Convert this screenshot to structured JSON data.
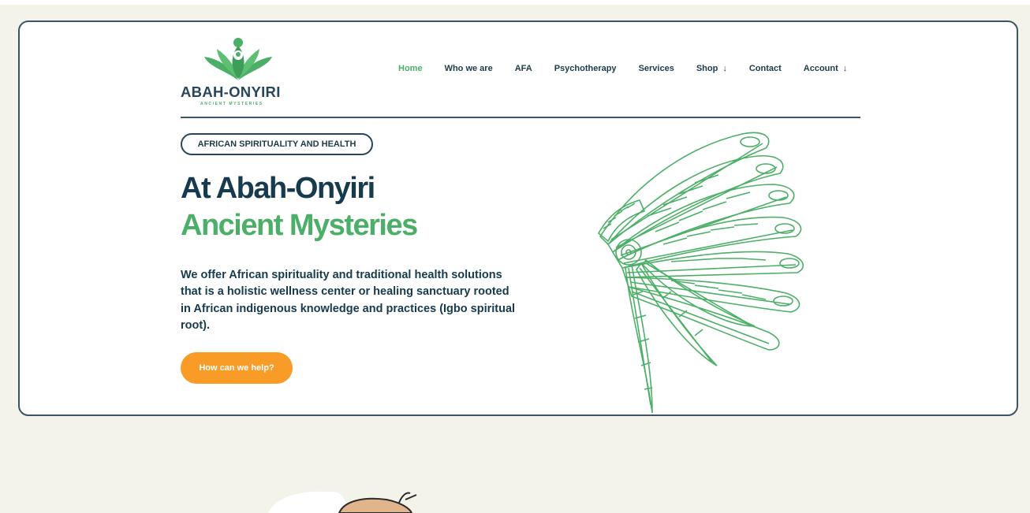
{
  "brand": {
    "name": "ABAH-ONYIRI",
    "tagline": "ANCIENT MYSTERIES"
  },
  "nav": {
    "items": [
      {
        "label": "Home",
        "active": true
      },
      {
        "label": "Who we are"
      },
      {
        "label": "AFA"
      },
      {
        "label": "Psychotherapy"
      },
      {
        "label": "Services"
      },
      {
        "label": "Shop",
        "dropdown": true
      },
      {
        "label": "Contact"
      },
      {
        "label": "Account",
        "dropdown": true
      }
    ]
  },
  "hero": {
    "badge": "AFRICAN SPIRITUALITY AND HEALTH",
    "title_line1": "At Abah-Onyiri",
    "title_line2": "Ancient Mysteries",
    "description": "We offer African spirituality and traditional health solutions that is a holistic wellness center or healing sanctuary rooted in African indigenous knowledge and practices (Igbo spiritual root).",
    "cta_label": "How can we help?",
    "illustration": "feather-headdress-illustration"
  },
  "colors": {
    "background": "#f3f3ea",
    "dark_text": "#163a4e",
    "accent_green": "#4caf67",
    "cta_orange": "#f99c27",
    "border": "#3c5464"
  }
}
